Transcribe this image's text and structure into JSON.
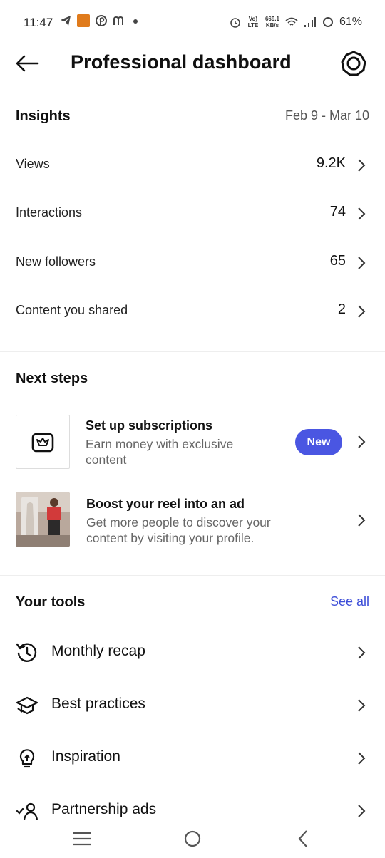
{
  "status_bar": {
    "time": "11:47",
    "speed_value": "669.1",
    "speed_unit": "KB/s",
    "volte": "Vo) LTE",
    "battery": "61%"
  },
  "header": {
    "title": "Professional dashboard",
    "back_icon": "arrow-left-icon",
    "settings_icon": "gear-icon"
  },
  "insights": {
    "heading": "Insights",
    "date_range": "Feb 9 - Mar 10",
    "rows": [
      {
        "label": "Views",
        "value": "9.2K"
      },
      {
        "label": "Interactions",
        "value": "74"
      },
      {
        "label": "New followers",
        "value": "65"
      },
      {
        "label": "Content you shared",
        "value": "2"
      }
    ]
  },
  "next_steps": {
    "heading": "Next steps",
    "items": [
      {
        "title": "Set up subscriptions",
        "description": "Earn money with exclusive content",
        "badge": "New",
        "icon": "crown-icon"
      },
      {
        "title": "Boost your reel into an ad",
        "description": "Get more people to discover your content by visiting your profile.",
        "icon": "reel-thumbnail"
      }
    ]
  },
  "tools": {
    "heading": "Your tools",
    "see_all": "See all",
    "items": [
      {
        "label": "Monthly recap",
        "icon": "history-icon"
      },
      {
        "label": "Best practices",
        "icon": "graduation-cap-icon"
      },
      {
        "label": "Inspiration",
        "icon": "lightbulb-icon"
      },
      {
        "label": "Partnership ads",
        "icon": "partner-check-icon"
      }
    ]
  },
  "colors": {
    "accent": "#4a56e2",
    "link": "#3d4ed8",
    "text_primary": "#111111",
    "text_secondary": "#666666"
  }
}
